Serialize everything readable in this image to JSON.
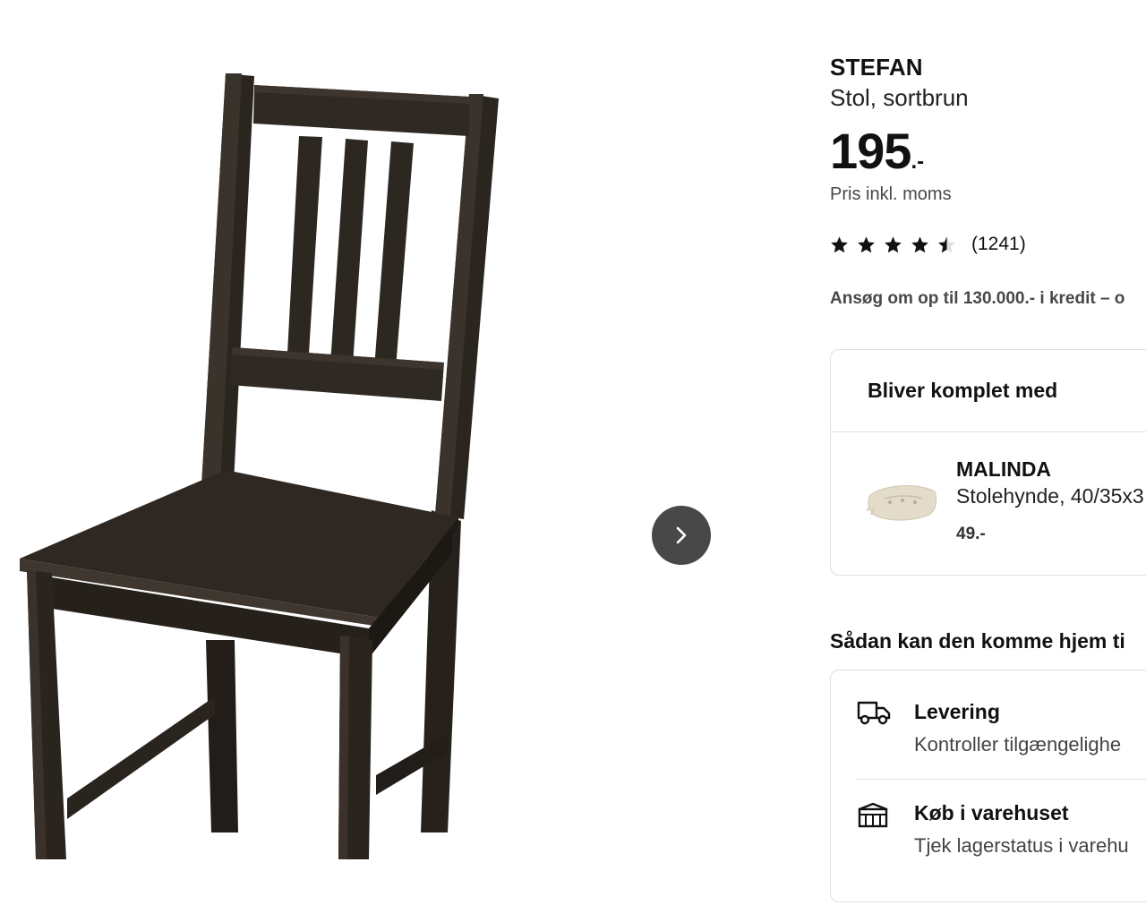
{
  "product": {
    "name": "STEFAN",
    "description": "Stol, sortbrun",
    "price_integer": "195",
    "price_suffix": ".-",
    "price_note": "Pris inkl. moms"
  },
  "rating": {
    "value": 4.5,
    "max": 5,
    "review_count": "(1241)"
  },
  "credit_text": "Ansøg om op til 130.000.- i kredit – o",
  "complete_with": {
    "title": "Bliver komplet med",
    "item": {
      "name": "MALINDA",
      "description": "Stolehynde, 40/35x3",
      "price": "49.-"
    }
  },
  "delivery": {
    "heading": "Sådan kan den komme hjem ti",
    "options": [
      {
        "title": "Levering",
        "subtitle": "Kontroller tilgængelighe",
        "icon": "truck-icon"
      },
      {
        "title": "Køb i varehuset",
        "subtitle": "Tjek lagerstatus i varehu",
        "icon": "store-icon"
      }
    ]
  },
  "gallery": {
    "next_icon": "chevron-right-icon"
  },
  "colors": {
    "chair_wood": "#2e2822",
    "nav_button": "#484848",
    "star": "#111111",
    "star_empty": "#dfdfdf",
    "border": "#dfdfdf"
  }
}
